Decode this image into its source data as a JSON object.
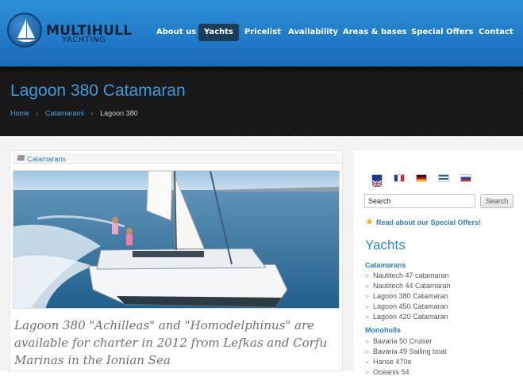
{
  "brand": {
    "name": "MULTIHULL",
    "sub": "YACHTING"
  },
  "nav": [
    "About us",
    "Yachts",
    "Pricelist",
    "Availability",
    "Areas & bases",
    "Special Offers",
    "Contact"
  ],
  "nav_active": "Yachts",
  "page": {
    "title": "Lagoon 380 Catamaran",
    "breadcrumb": [
      "Home",
      "Catamarans",
      "Lagoon 380"
    ]
  },
  "main": {
    "category": "Catamarans",
    "intro": "Lagoon 380 \"Achilleas\" and \"Homodelphinus\" are available for charter in 2012 from Lefkas and Corfu Marinas in the Ionian Sea"
  },
  "sidebar": {
    "flags": [
      "english-flag",
      "french-flag",
      "german-flag",
      "greek-flag",
      "russian-flag"
    ],
    "search_value": "Search",
    "search_button": "Search",
    "special_offers": "Read about our Special Offers!",
    "yachts_heading": "Yachts",
    "groups": [
      {
        "name": "Catamarans",
        "items": [
          "Nautitech 47 catamaran",
          "Nautitech 44 Catamaran",
          "Lagoon 380 Catamaran",
          "Lagoon 450 Catamaran",
          "Lagoon 420 Catamaran"
        ]
      },
      {
        "name": "Monohulls",
        "items": [
          "Bavaria 50 Cruiser",
          "Bavaria 49 Sailing boat",
          "Hanse 470e",
          "Oceanis 54"
        ]
      }
    ]
  },
  "colors": {
    "header_blue": "#1e76c4",
    "accent_blue": "#3a9be0",
    "link_blue": "#2a7fc6",
    "title_band": "#1a1a1a"
  }
}
